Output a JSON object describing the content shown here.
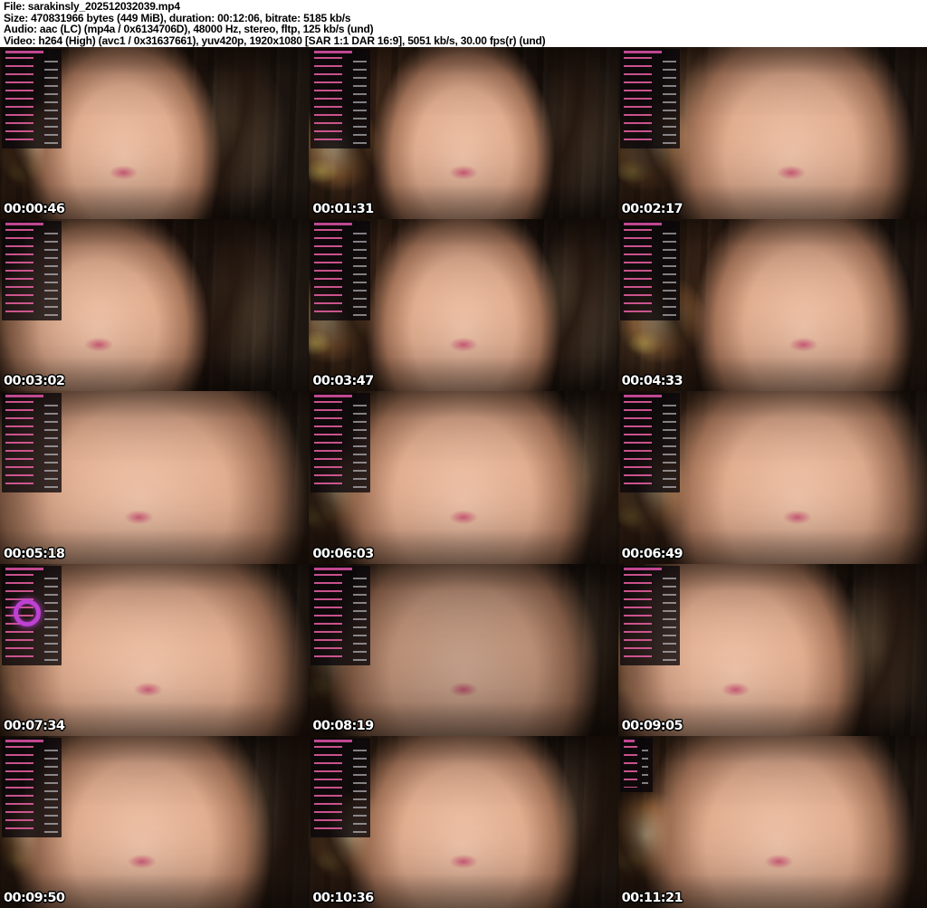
{
  "header": {
    "lines": [
      "File: sarakinsly_202512032039.mp4",
      "Size: 470831966 bytes (449 MiB), duration: 00:12:06, bitrate: 5185 kb/s",
      "Audio: aac (LC) (mp4a / 0x6134706D), 48000 Hz, stereo, fltp, 125 kb/s (und)",
      "Video: h264 (High) (avc1 / 0x31637661), yuv420p, 1920x1080 [SAR 1:1 DAR 16:9], 5051 kb/s, 30.00 fps(r) (und)"
    ]
  },
  "thumbnails": [
    {
      "timestamp": "00:00:46"
    },
    {
      "timestamp": "00:01:31"
    },
    {
      "timestamp": "00:02:17"
    },
    {
      "timestamp": "00:03:02"
    },
    {
      "timestamp": "00:03:47"
    },
    {
      "timestamp": "00:04:33"
    },
    {
      "timestamp": "00:05:18"
    },
    {
      "timestamp": "00:06:03"
    },
    {
      "timestamp": "00:06:49"
    },
    {
      "timestamp": "00:07:34"
    },
    {
      "timestamp": "00:08:19"
    },
    {
      "timestamp": "00:09:05"
    },
    {
      "timestamp": "00:09:50"
    },
    {
      "timestamp": "00:10:36"
    },
    {
      "timestamp": "00:11:21"
    }
  ]
}
